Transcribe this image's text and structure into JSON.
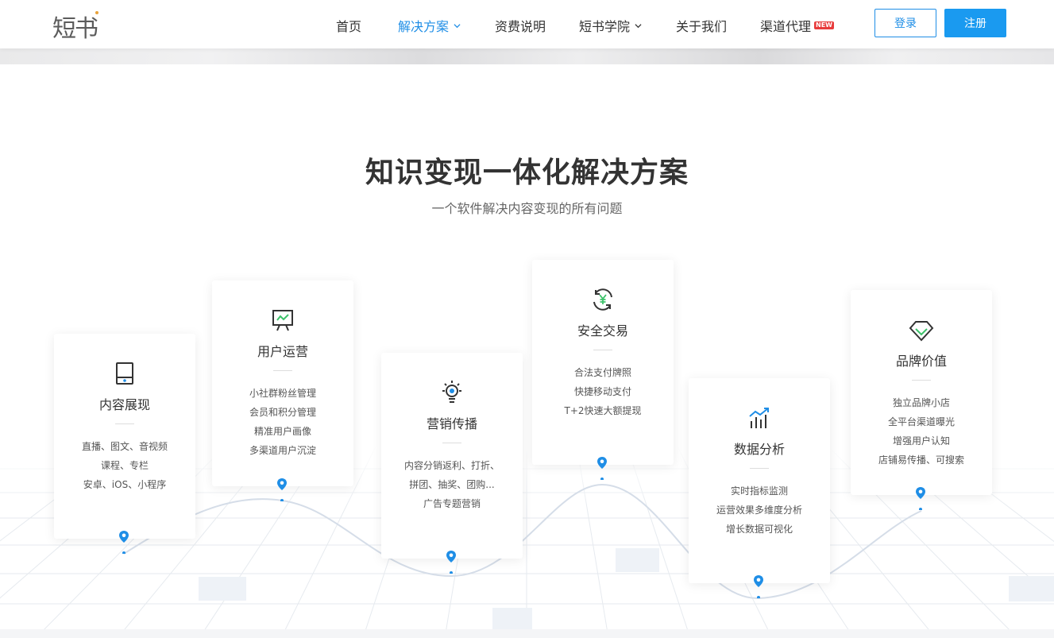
{
  "header": {
    "logo_text": "短书",
    "nav": [
      {
        "label": "首页",
        "active": false,
        "dropdown": false
      },
      {
        "label": "解决方案",
        "active": true,
        "dropdown": true
      },
      {
        "label": "资费说明",
        "active": false,
        "dropdown": false
      },
      {
        "label": "短书学院",
        "active": false,
        "dropdown": true
      },
      {
        "label": "关于我们",
        "active": false,
        "dropdown": false
      },
      {
        "label": "渠道代理",
        "active": false,
        "dropdown": false,
        "badge": "NEW"
      }
    ],
    "login_label": "登录",
    "register_label": "注册"
  },
  "section": {
    "title": "知识变现一体化解决方案",
    "subtitle": "一个软件解决内容变现的所有问题"
  },
  "cards": [
    {
      "icon": "tablet-icon",
      "title": "内容展现",
      "lines": [
        "直播、图文、音视频",
        "课程、专栏",
        "安卓、iOS、小程序"
      ]
    },
    {
      "icon": "presentation-chart-icon",
      "title": "用户运营",
      "lines": [
        "小社群粉丝管理",
        "会员和积分管理",
        "精准用户画像",
        "多渠道用户沉淀"
      ]
    },
    {
      "icon": "lightbulb-icon",
      "title": "营销传播",
      "lines": [
        "内容分销返利、打折、",
        "拼团、抽奖、团购...",
        "广告专题营销"
      ]
    },
    {
      "icon": "yuan-cycle-icon",
      "title": "安全交易",
      "lines": [
        "合法支付牌照",
        "快捷移动支付",
        "T+2快速大额提现"
      ]
    },
    {
      "icon": "bar-chart-trend-icon",
      "title": "数据分析",
      "lines": [
        "实时指标监测",
        "运营效果多维度分析",
        "增长数据可视化"
      ]
    },
    {
      "icon": "diamond-icon",
      "title": "品牌价值",
      "lines": [
        "独立品牌小店",
        "全平台渠道曝光",
        "增强用户认知",
        "店铺易传播、可搜索"
      ]
    }
  ],
  "colors": {
    "accent": "#1f8ee6",
    "register_bg": "#1a9af0",
    "icon_green": "#3cc26a",
    "badge_red": "#e83b3b"
  }
}
